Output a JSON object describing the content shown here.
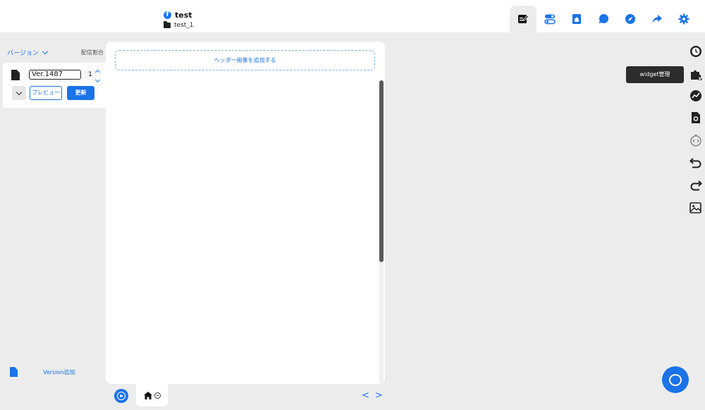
{
  "project": {
    "name": "test",
    "sub": "test_1"
  },
  "toolbar": {
    "items": [
      {
        "name": "edit-page",
        "icon": "edit-page-icon",
        "active": true
      },
      {
        "name": "toggle",
        "icon": "toggle-icon"
      },
      {
        "name": "bookmark",
        "icon": "bookmark-icon"
      },
      {
        "name": "chat",
        "icon": "chat-icon"
      },
      {
        "name": "compass",
        "icon": "compass-icon"
      },
      {
        "name": "share",
        "icon": "share-icon"
      },
      {
        "name": "settings",
        "icon": "gear-icon"
      }
    ]
  },
  "left_panel": {
    "version_label": "バージョン",
    "distribution_label": "配信割合",
    "version_value": "Ver.1487",
    "ratio_value": "1",
    "preview_label": "プレビュー",
    "update_label": "更新",
    "add_version_label": "Version追加"
  },
  "canvas": {
    "header_add_label": "ヘッダー画像を追加する"
  },
  "bottom": {
    "prev": "<",
    "next": ">"
  },
  "tooltip": {
    "text": "widget管理"
  },
  "colors": {
    "accent": "#1a73e8",
    "tooltip_bg": "#2c2c2c",
    "background": "#ececec"
  }
}
